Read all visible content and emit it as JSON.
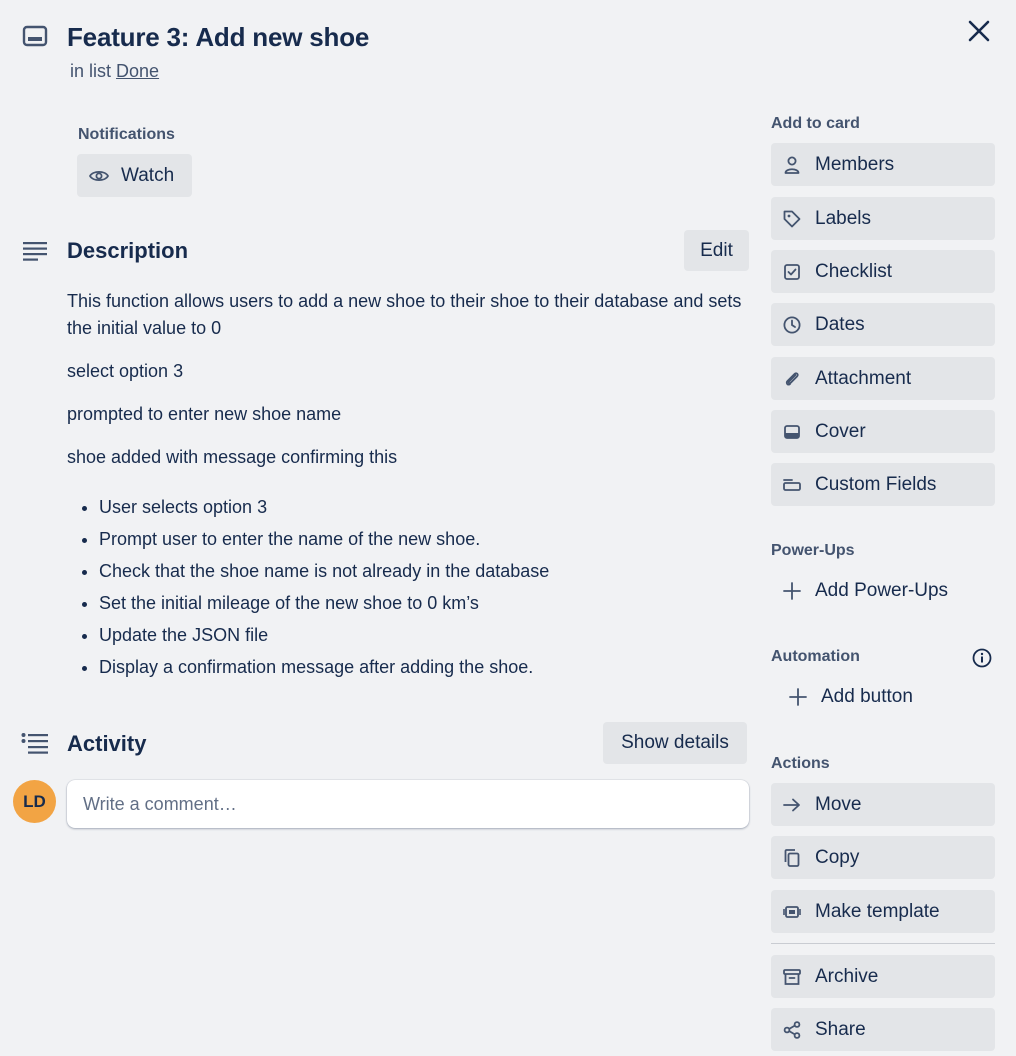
{
  "header": {
    "title": "Feature 3: Add new shoe",
    "in_list_prefix": "in list",
    "list_name": "Done"
  },
  "notifications": {
    "label": "Notifications",
    "watch_label": "Watch"
  },
  "description": {
    "title": "Description",
    "edit_label": "Edit",
    "paragraphs": [
      "This function allows users to add a new shoe to their shoe to their database and sets the initial value to 0",
      "select option 3",
      "prompted to enter new shoe name",
      "shoe added with message confirming this"
    ],
    "bullets": [
      "User selects option 3",
      "Prompt user to enter the name of the new shoe.",
      "Check that the shoe name is not already in the database",
      "Set the initial mileage of the new shoe to 0 km’s",
      "Update the JSON file",
      "Display a confirmation message after adding the shoe."
    ]
  },
  "activity": {
    "title": "Activity",
    "show_details_label": "Show details",
    "avatar_initials": "LD",
    "avatar_color": "#f2a444",
    "comment_placeholder": "Write a comment…"
  },
  "sidebar": {
    "add_to_card_label": "Add to card",
    "add_to_card": [
      {
        "label": "Members",
        "icon": "person-icon"
      },
      {
        "label": "Labels",
        "icon": "tag-icon"
      },
      {
        "label": "Checklist",
        "icon": "checkbox-icon"
      },
      {
        "label": "Dates",
        "icon": "clock-icon"
      },
      {
        "label": "Attachment",
        "icon": "paperclip-icon"
      },
      {
        "label": "Cover",
        "icon": "cover-icon"
      },
      {
        "label": "Custom Fields",
        "icon": "fields-icon"
      }
    ],
    "powerups_label": "Power-Ups",
    "add_powerups_label": "Add Power-Ups",
    "automation_label": "Automation",
    "add_button_label": "Add button",
    "actions_label": "Actions",
    "actions": [
      {
        "label": "Move",
        "icon": "arrow-right-icon"
      },
      {
        "label": "Copy",
        "icon": "copy-icon"
      },
      {
        "label": "Make template",
        "icon": "template-icon"
      },
      {
        "label": "Archive",
        "icon": "archive-icon"
      },
      {
        "label": "Share",
        "icon": "share-icon"
      }
    ]
  },
  "colors": {
    "background": "#f1f2f4",
    "button_bg": "#e3e5e8",
    "text": "#172b4d",
    "subtle_text": "#44546f"
  }
}
